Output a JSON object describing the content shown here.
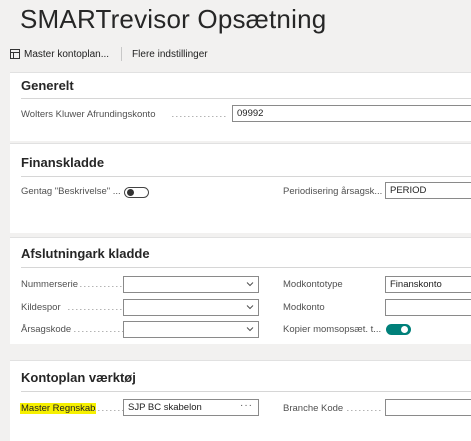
{
  "page": {
    "title": "SMARTrevisor Opsætning"
  },
  "actions": {
    "master_kontoplan": "Master kontoplan...",
    "flere_indstillinger": "Flere indstillinger"
  },
  "sections": {
    "generelt": {
      "title": "Generelt",
      "wolters_label": "Wolters Kluwer Afrundingskonto",
      "wolters_value": "09992"
    },
    "finanskladde": {
      "title": "Finanskladde",
      "gentag_label": "Gentag \"Beskrivelse\" ...",
      "gentag_toggle": "off",
      "periodisering_label": "Periodisering årsagsk...",
      "periodisering_value": "PERIOD"
    },
    "afslutningark": {
      "title": "Afslutningark kladde",
      "nummerserie_label": "Nummerserie",
      "nummerserie_value": "",
      "kildespor_label": "Kildespor",
      "kildespor_value": "",
      "aarsagskode_label": "Årsagskode",
      "aarsagskode_value": "",
      "modkontotype_label": "Modkontotype",
      "modkontotype_value": "Finanskonto",
      "modkonto_label": "Modkonto",
      "modkonto_value": "",
      "kopier_label": "Kopier momsopsæt. t...",
      "kopier_toggle": "on"
    },
    "kontoplan": {
      "title": "Kontoplan værktøj",
      "master_regnskab_label": "Master Regnskab",
      "master_regnskab_value": "SJP BC skabelon",
      "branche_label": "Branche Kode",
      "branche_value": ""
    }
  },
  "colors": {
    "accent": "#00807a",
    "highlight": "#f6f000",
    "background": "#f2f1f0"
  }
}
